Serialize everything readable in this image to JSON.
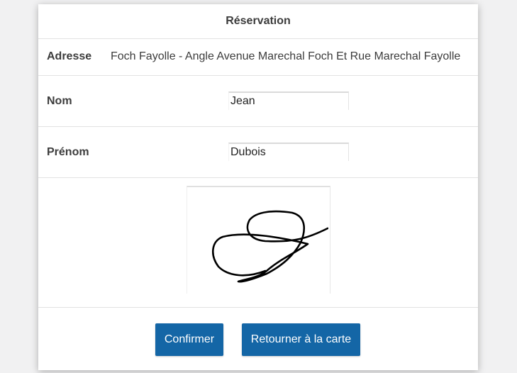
{
  "modal": {
    "title": "Réservation"
  },
  "address": {
    "label": "Adresse",
    "value": "Foch Fayolle - Angle Avenue Marechal Foch Et Rue Marechal Fayolle"
  },
  "form": {
    "nom": {
      "label": "Nom",
      "value": "Jean"
    },
    "prenom": {
      "label": "Prénom",
      "value": "Dubois"
    }
  },
  "signature": {
    "stroke_color": "#000000"
  },
  "buttons": {
    "confirm_label": "Confirmer",
    "return_label": "Retourner à la carte",
    "color": "#1466a6"
  }
}
